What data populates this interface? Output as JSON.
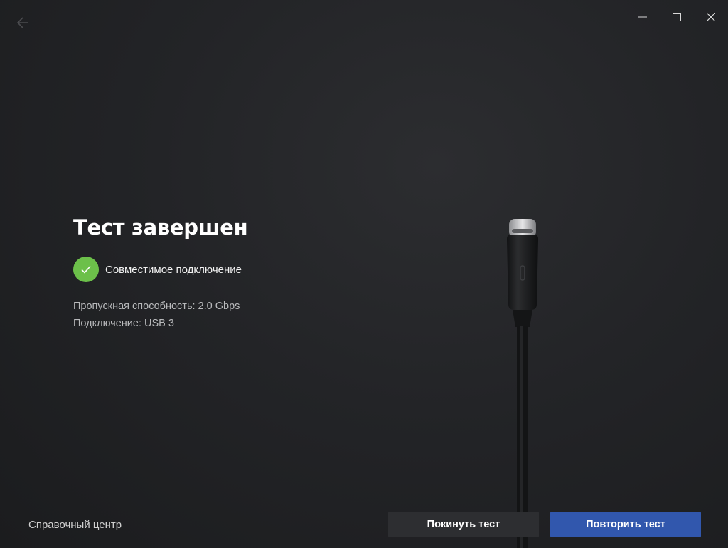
{
  "window": {
    "back_icon": "arrow-left-icon",
    "controls": [
      "minimize-icon",
      "maximize-icon",
      "close-icon"
    ]
  },
  "main": {
    "title": "Тест завершен",
    "status": {
      "icon": "checkmark-icon",
      "text": "Совместимое подключение",
      "color": "#6cc04a"
    },
    "details": {
      "bandwidth": "Пропускная способность: 2.0 Gbps",
      "connection": "Подключение: USB 3"
    },
    "illustration": "usb-c-cable"
  },
  "footer": {
    "help_link": "Справочный центр",
    "leave_button": "Покинуть тест",
    "retry_button": "Повторить тест",
    "accent_color": "#3157ad"
  }
}
